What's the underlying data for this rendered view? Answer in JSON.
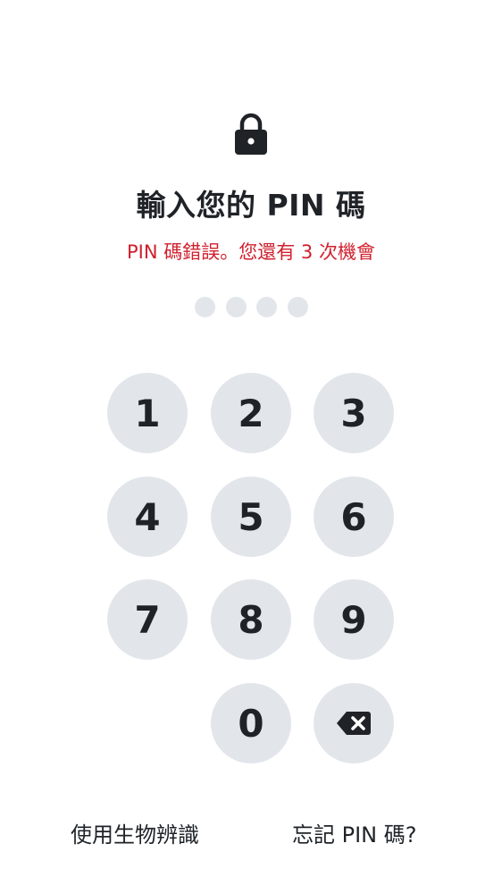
{
  "header": {
    "icon": "lock-icon",
    "title": "輸入您的 PIN 碼",
    "error_message": "PIN 碼錯誤。您還有 3 次機會"
  },
  "pin": {
    "length": 4,
    "entered": 0
  },
  "keypad": {
    "keys": [
      "1",
      "2",
      "3",
      "4",
      "5",
      "6",
      "7",
      "8",
      "9",
      "0"
    ],
    "delete_icon": "backspace-icon"
  },
  "footer": {
    "biometric_label": "使用生物辨識",
    "forgot_label": "忘記 PIN 碼?"
  },
  "colors": {
    "error": "#d0202e",
    "key_background": "#e2e6eb",
    "text": "#1f2328"
  }
}
